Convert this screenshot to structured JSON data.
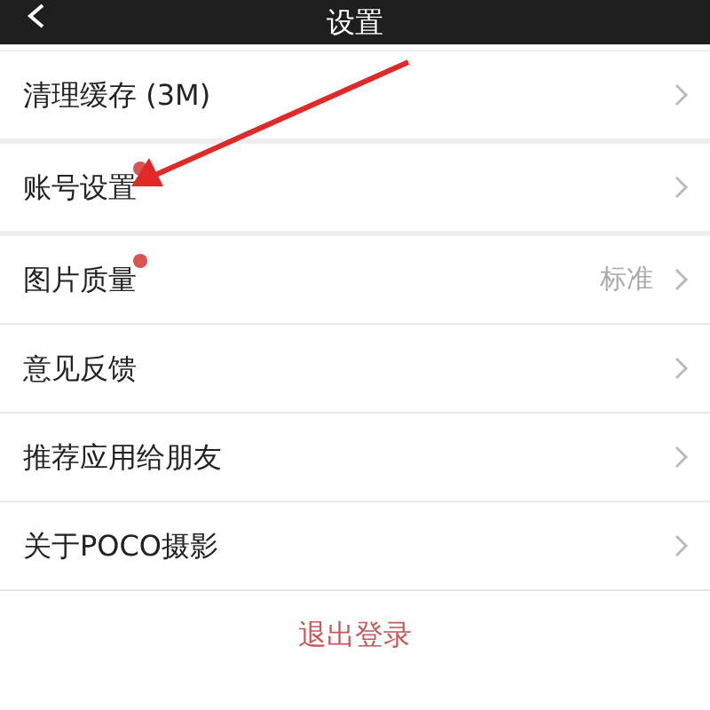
{
  "header": {
    "title": "设置"
  },
  "sections": [
    {
      "items": [
        {
          "label": "清理缓存 (3M)",
          "badge": false
        }
      ]
    },
    {
      "items": [
        {
          "label": "账号设置",
          "badge": true
        }
      ]
    },
    {
      "items": [
        {
          "label": "图片质量",
          "badge": true,
          "value": "标准"
        },
        {
          "label": "意见反馈",
          "badge": false
        },
        {
          "label": "推荐应用给朋友",
          "badge": false
        },
        {
          "label": "关于POCO摄影",
          "badge": false
        }
      ]
    }
  ],
  "logout_button": "退出登录"
}
